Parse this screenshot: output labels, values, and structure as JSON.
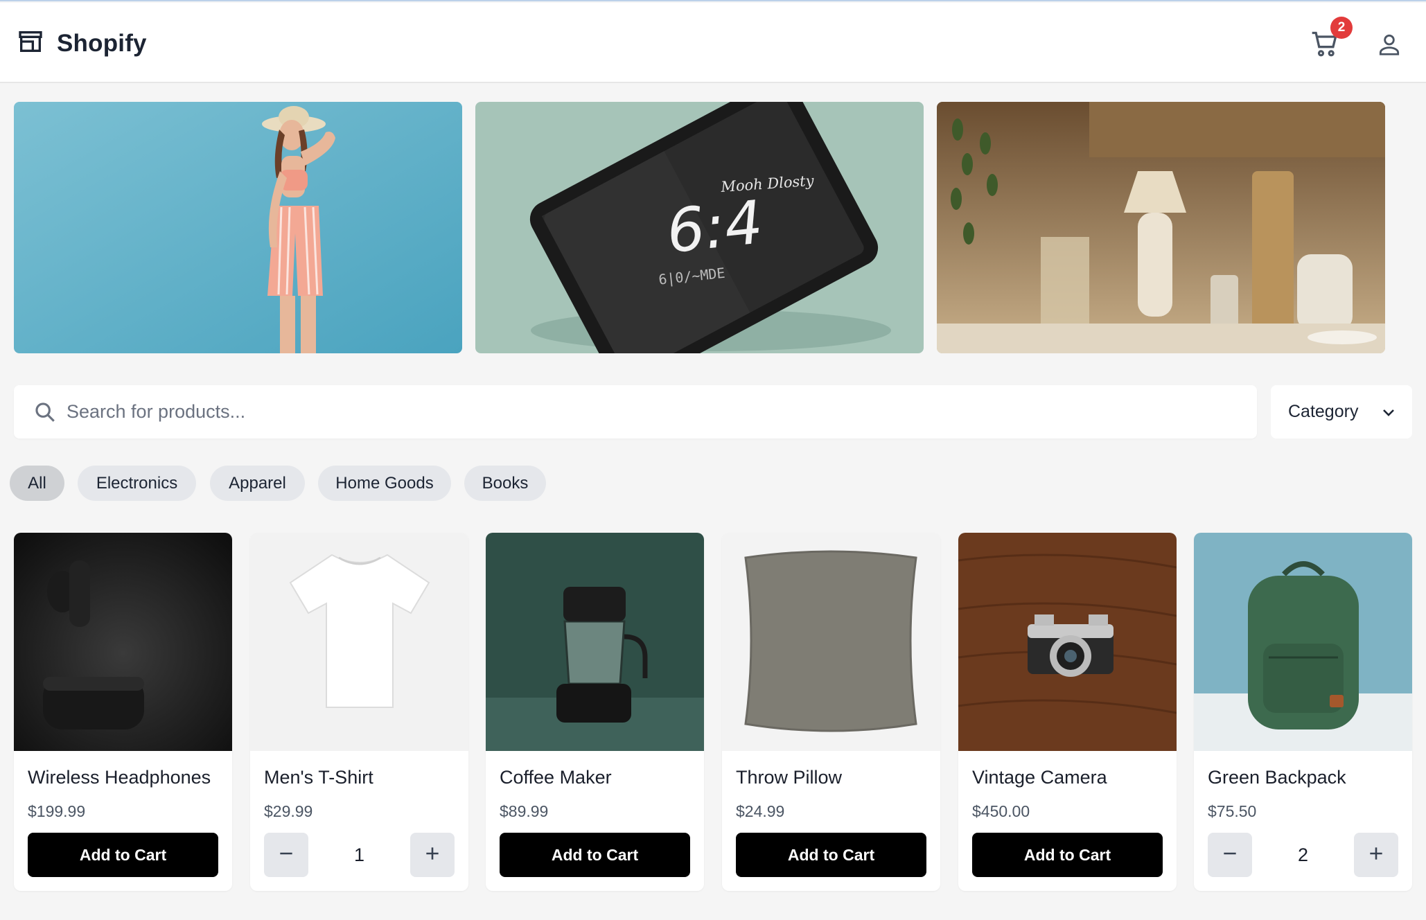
{
  "header": {
    "brand": "Shopify",
    "cart_count": "2"
  },
  "search": {
    "placeholder": "Search for products...",
    "value": ""
  },
  "category_select": {
    "label": "Category"
  },
  "chips": [
    "All",
    "Electronics",
    "Apparel",
    "Home Goods",
    "Books"
  ],
  "active_chip": "All",
  "banners": [
    {
      "subject": "woman in striped summer outfit and straw hat"
    },
    {
      "subject": "tablet showing clock screen",
      "screen_text": "6:4"
    },
    {
      "subject": "woven lamps and home decor"
    }
  ],
  "products": [
    {
      "name": "Wireless Headphones",
      "price": "$199.99",
      "action": "Add to Cart",
      "image": "earbuds-image"
    },
    {
      "name": "Men's T-Shirt",
      "price": "$29.99",
      "quantity": "1",
      "image": "tshirt-image"
    },
    {
      "name": "Coffee Maker",
      "price": "$89.99",
      "action": "Add to Cart",
      "image": "coffee-maker-image"
    },
    {
      "name": "Throw Pillow",
      "price": "$24.99",
      "action": "Add to Cart",
      "image": "pillow-image"
    },
    {
      "name": "Vintage Camera",
      "price": "$450.00",
      "action": "Add to Cart",
      "image": "camera-image"
    },
    {
      "name": "Green Backpack",
      "price": "$75.50",
      "quantity": "2",
      "image": "backpack-image"
    }
  ],
  "colors": {
    "badge": "#e23b3b",
    "button": "#000000",
    "chip": "#e5e7eb",
    "chip_active": "#cfd1d4"
  }
}
